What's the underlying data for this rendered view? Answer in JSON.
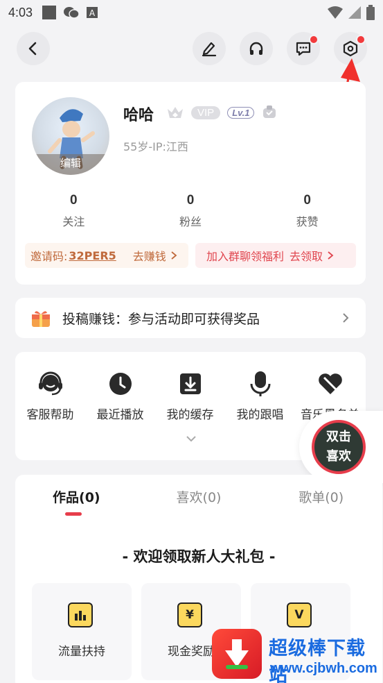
{
  "statusbar": {
    "time": "4:03"
  },
  "profile": {
    "avatar_label": "编辑",
    "nickname": "哈哈",
    "vip": "VIP",
    "level": "Lv.1",
    "subtitle": "55岁-IP:江西",
    "stats": [
      {
        "num": "0",
        "label": "关注"
      },
      {
        "num": "0",
        "label": "粉丝"
      },
      {
        "num": "0",
        "label": "获赞"
      }
    ],
    "invite": {
      "label": "邀请码:",
      "code": "32PER5",
      "action": "去赚钱"
    },
    "group": {
      "label": "加入群聊领福利",
      "action": "去领取"
    }
  },
  "banner": {
    "text": "投稿赚钱：参与活动即可获得奖品"
  },
  "shortcuts": [
    {
      "label": "客服帮助",
      "icon": "headset-icon"
    },
    {
      "label": "最近播放",
      "icon": "clock-icon"
    },
    {
      "label": "我的缓存",
      "icon": "download-icon"
    },
    {
      "label": "我的跟唱",
      "icon": "microphone-icon"
    },
    {
      "label": "音乐黑名单",
      "icon": "broken-heart-icon"
    }
  ],
  "floating": {
    "line1": "双击",
    "line2": "喜欢"
  },
  "tabs": [
    {
      "label": "作品(0)",
      "active": true
    },
    {
      "label": "喜欢(0)",
      "active": false
    },
    {
      "label": "歌单(0)",
      "active": false
    }
  ],
  "gift": {
    "title": "- 欢迎领取新人大礼包 -",
    "items": [
      {
        "label": "流量扶持",
        "glyph": "",
        "icon": "chart-icon"
      },
      {
        "label": "现金奖励",
        "glyph": "¥",
        "icon": "yen-icon"
      },
      {
        "label": "",
        "glyph": "V",
        "icon": "vip-icon"
      }
    ]
  },
  "watermark": {
    "title": "超级棒下载站",
    "url": "www.cjbwh.com"
  },
  "colors": {
    "accent": "#e73d4b",
    "invite": "#c06a3c",
    "group": "#e0454e",
    "watermark": "#1a6be0"
  }
}
